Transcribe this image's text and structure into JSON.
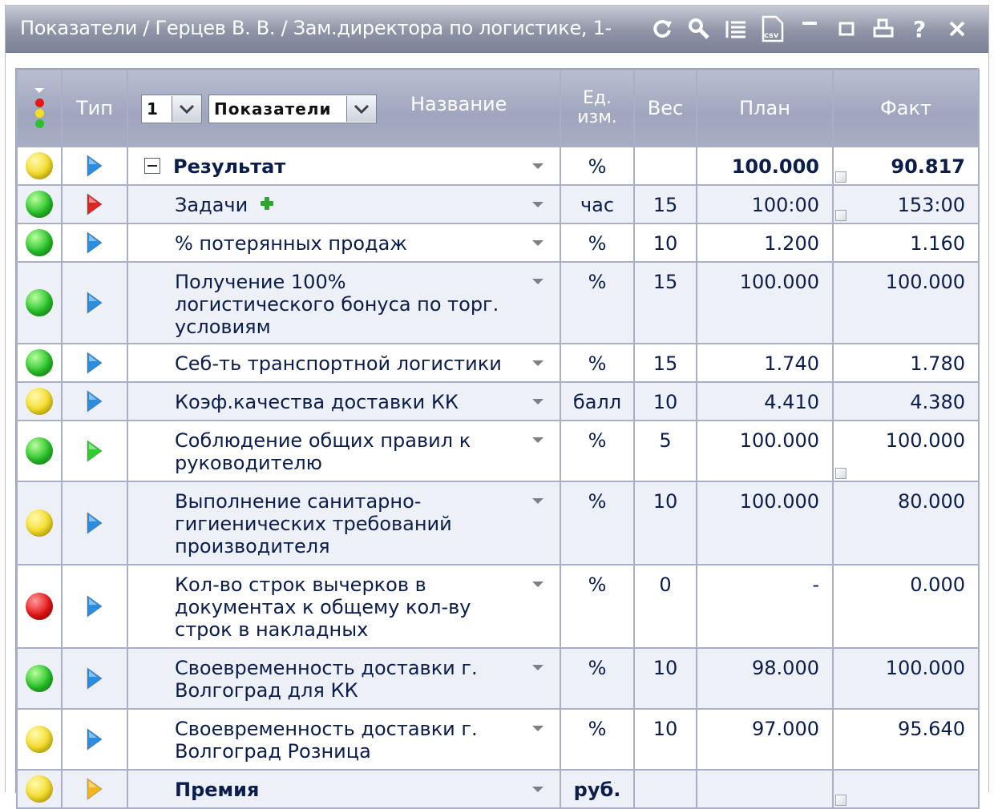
{
  "window": {
    "title": "Показатели / Герцев В. В. / Зам.директора по логистике, 1-"
  },
  "toolbar": {
    "icons": [
      "refresh-icon",
      "search-icon",
      "list-icon",
      "csv-export-icon",
      "minimize-icon",
      "maximize-icon",
      "print-icon",
      "help-icon",
      "close-icon"
    ]
  },
  "header": {
    "type": "Тип",
    "period_value": "1",
    "group_value": "Показатели",
    "name": "Название",
    "unit_line1": "Ед.",
    "unit_line2": "изм.",
    "weight": "Вес",
    "plan": "План",
    "fact": "Факт"
  },
  "colors": {
    "green": "#29c22a",
    "yellow": "#f3dc2a",
    "red": "#e51717",
    "blue_type": "#2b8de0",
    "red_type": "#e02424",
    "green_type": "#2ccf2c",
    "orange_type": "#f2b51c"
  },
  "rows": [
    {
      "status": "yellow",
      "type": "blue",
      "name": "Результат",
      "bold": true,
      "expander": true,
      "unit": "%",
      "weight": "",
      "plan": "100.000",
      "fact": "90.817",
      "note": true,
      "alt": false,
      "h": 48
    },
    {
      "status": "green",
      "type": "red",
      "name": "Задачи",
      "plus": true,
      "unit": "час",
      "weight": "15",
      "plan": "100:00",
      "fact": "153:00",
      "note": true,
      "alt": true,
      "h": 48
    },
    {
      "status": "green",
      "type": "blue",
      "name": "% потерянных продаж",
      "unit": "%",
      "weight": "10",
      "plan": "1.200",
      "fact": "1.160",
      "alt": false,
      "h": 48
    },
    {
      "status": "green",
      "type": "blue",
      "name": "Получение 100% логистического бонуса по торг. условиям",
      "unit": "%",
      "weight": "15",
      "plan": "100.000",
      "fact": "100.000",
      "alt": true,
      "h": 76
    },
    {
      "status": "green",
      "type": "blue",
      "name": "Себ-ть транспортной логистики",
      "unit": "%",
      "weight": "15",
      "plan": "1.740",
      "fact": "1.780",
      "alt": false,
      "h": 48
    },
    {
      "status": "yellow",
      "type": "blue",
      "name": "Коэф.качества доставки КК",
      "unit": "балл",
      "weight": "10",
      "plan": "4.410",
      "fact": "4.380",
      "alt": true,
      "h": 48
    },
    {
      "status": "green",
      "type": "green",
      "name": "Соблюдение общих правил к руководителю",
      "unit": "%",
      "weight": "5",
      "plan": "100.000",
      "fact": "100.000",
      "note": true,
      "alt": false,
      "h": 76
    },
    {
      "status": "yellow",
      "type": "blue",
      "name": "Выполнение санитарно-гигиенических требований производителя",
      "unit": "%",
      "weight": "10",
      "plan": "100.000",
      "fact": "80.000",
      "alt": true,
      "h": 104
    },
    {
      "status": "red",
      "type": "blue",
      "name": "Кол-во строк вычерков в документах к общему кол-ву строк в накладных",
      "unit": "%",
      "weight": "0",
      "plan": "-",
      "fact": "0.000",
      "alt": false,
      "h": 104
    },
    {
      "status": "green",
      "type": "blue",
      "name": "Своевременность доставки г. Волгоград для КК",
      "unit": "%",
      "weight": "10",
      "plan": "98.000",
      "fact": "100.000",
      "alt": true,
      "h": 76
    },
    {
      "status": "yellow",
      "type": "blue",
      "name": "Своевременность доставки г. Волгоград Розница",
      "unit": "%",
      "weight": "10",
      "plan": "97.000",
      "fact": "95.640",
      "alt": false,
      "h": 76
    },
    {
      "status": "yellow",
      "type": "orange",
      "name": "Премия",
      "bold": true,
      "unit": "руб.",
      "unit_bold": true,
      "weight": "",
      "plan": "",
      "fact": "",
      "note": true,
      "alt": true,
      "h": 48
    }
  ]
}
